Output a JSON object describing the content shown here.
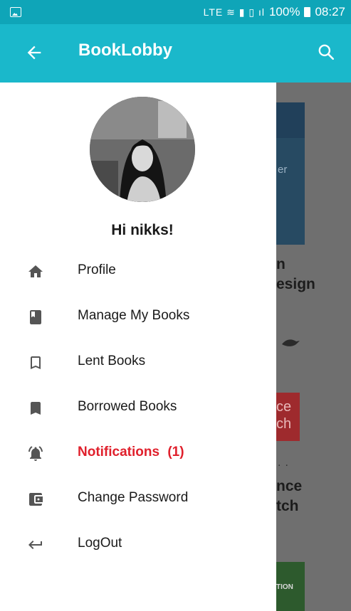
{
  "status_bar": {
    "battery": "100%",
    "time": "08:27",
    "network_text": "LTE"
  },
  "app_bar": {
    "title": "BookLobby"
  },
  "drawer": {
    "greeting": "Hi nikks!",
    "items": [
      {
        "label": "Profile",
        "icon": "home-icon"
      },
      {
        "label": "Manage My Books",
        "icon": "book-icon"
      },
      {
        "label": "Lent Books",
        "icon": "bookmark-outline-icon"
      },
      {
        "label": "Borrowed Books",
        "icon": "bookmark-icon"
      },
      {
        "label": "Notifications",
        "icon": "bell-ringing-icon",
        "count": "(1)"
      },
      {
        "label": "Change Password",
        "icon": "wallet-icon"
      },
      {
        "label": "LogOut",
        "icon": "return-arrow-icon"
      }
    ]
  },
  "background": {
    "cover_word": "er",
    "text_1": "n",
    "text_2": "esign",
    "red_cover_text": "ce\nch",
    "text_3": "nce",
    "text_4": "tch",
    "green_cover_text": "TION"
  },
  "colors": {
    "status_bar": "#0fa5b8",
    "app_bar": "#1ab8cb",
    "notification_red": "#e0202c",
    "icon_gray": "#555555"
  }
}
